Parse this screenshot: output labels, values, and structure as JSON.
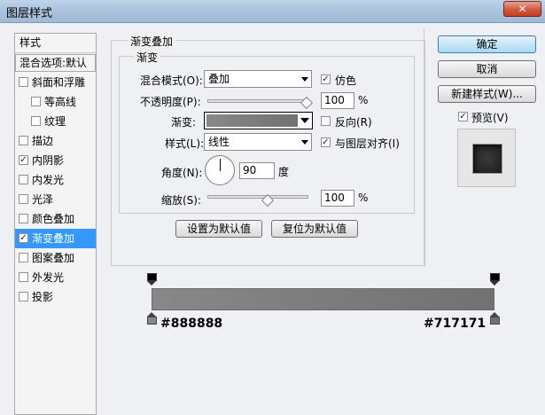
{
  "window": {
    "title": "图层样式",
    "close_glyph": "✕"
  },
  "left_list": {
    "header": "样式",
    "blend_options": "混合选项:默认",
    "items": [
      {
        "label": "斜面和浮雕",
        "checked": false,
        "indent": false
      },
      {
        "label": "等高线",
        "checked": false,
        "indent": true
      },
      {
        "label": "纹理",
        "checked": false,
        "indent": true
      },
      {
        "label": "描边",
        "checked": false,
        "indent": false
      },
      {
        "label": "内阴影",
        "checked": true,
        "indent": false
      },
      {
        "label": "内发光",
        "checked": false,
        "indent": false
      },
      {
        "label": "光泽",
        "checked": false,
        "indent": false
      },
      {
        "label": "颜色叠加",
        "checked": false,
        "indent": false
      },
      {
        "label": "渐变叠加",
        "checked": true,
        "indent": false,
        "selected": true
      },
      {
        "label": "图案叠加",
        "checked": false,
        "indent": false
      },
      {
        "label": "外发光",
        "checked": false,
        "indent": false
      },
      {
        "label": "投影",
        "checked": false,
        "indent": false
      }
    ]
  },
  "panel": {
    "outer_legend": "渐变叠加",
    "inner_legend": "渐变",
    "blend_mode_label": "混合模式(O):",
    "blend_mode_value": "叠加",
    "dither_label": "仿色",
    "dither_checked": true,
    "opacity_label": "不透明度(P):",
    "opacity_value": "100",
    "opacity_unit": "%",
    "gradient_label": "渐变:",
    "reverse_label": "反向(R)",
    "reverse_checked": false,
    "style_label": "样式(L):",
    "style_value": "线性",
    "align_label": "与图层对齐(I)",
    "align_checked": true,
    "angle_label": "角度(N):",
    "angle_value": "90",
    "angle_unit": "度",
    "scale_label": "缩放(S):",
    "scale_value": "100",
    "scale_unit": "%",
    "set_default": "设置为默认值",
    "reset_default": "复位为默认值"
  },
  "right": {
    "ok": "确定",
    "cancel": "取消",
    "new_style": "新建样式(W)...",
    "preview_label": "预览(V)",
    "preview_checked": true
  },
  "gradient_editor": {
    "left_color": "#888888",
    "right_color": "#717171",
    "left_label": "#888888",
    "right_label": "#717171"
  },
  "colors": {
    "selection": "#3399ff",
    "default_button": "#a9d9f4"
  }
}
